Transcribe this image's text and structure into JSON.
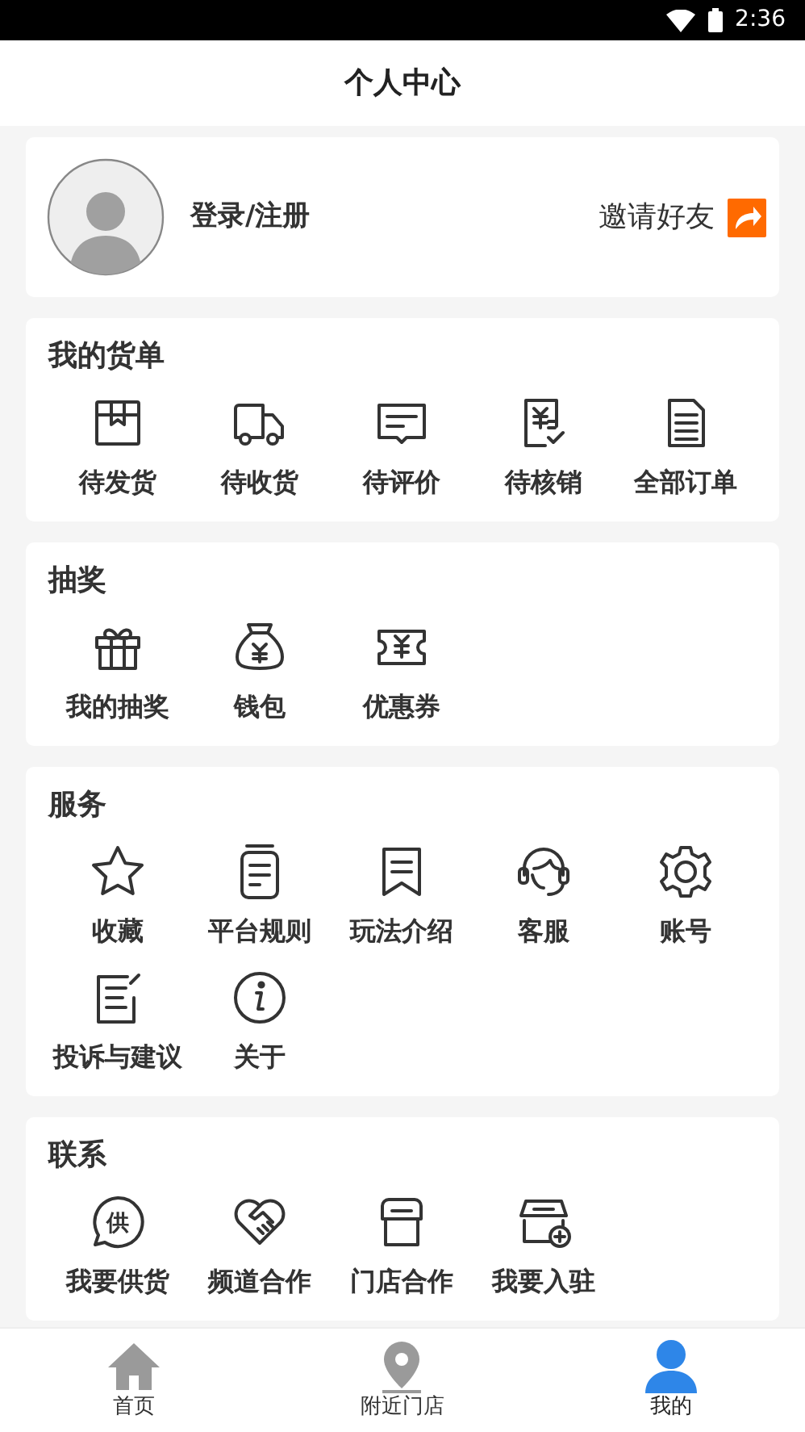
{
  "status_bar": {
    "time": "2:36"
  },
  "header": {
    "title": "个人中心"
  },
  "profile": {
    "login": "登录/注册",
    "invite": "邀请好友"
  },
  "sections": [
    {
      "title": "我的货单",
      "items": [
        {
          "label": "待发货"
        },
        {
          "label": "待收货"
        },
        {
          "label": "待评价"
        },
        {
          "label": "待核销"
        },
        {
          "label": "全部订单"
        }
      ]
    },
    {
      "title": "抽奖",
      "items": [
        {
          "label": "我的抽奖"
        },
        {
          "label": "钱包"
        },
        {
          "label": "优惠券"
        }
      ]
    },
    {
      "title": "服务",
      "items": [
        {
          "label": "收藏"
        },
        {
          "label": "平台规则"
        },
        {
          "label": "玩法介绍"
        },
        {
          "label": "客服"
        },
        {
          "label": "账号"
        },
        {
          "label": "投诉与建议"
        },
        {
          "label": "关于"
        }
      ]
    },
    {
      "title": "联系",
      "items": [
        {
          "label": "我要供货",
          "icon_text": "供"
        },
        {
          "label": "频道合作"
        },
        {
          "label": "门店合作"
        },
        {
          "label": "我要入驻"
        }
      ]
    }
  ],
  "tab_bar": [
    {
      "label": "首页",
      "selected": false
    },
    {
      "label": "附近门店",
      "selected": false
    },
    {
      "label": "我的",
      "selected": true
    }
  ]
}
